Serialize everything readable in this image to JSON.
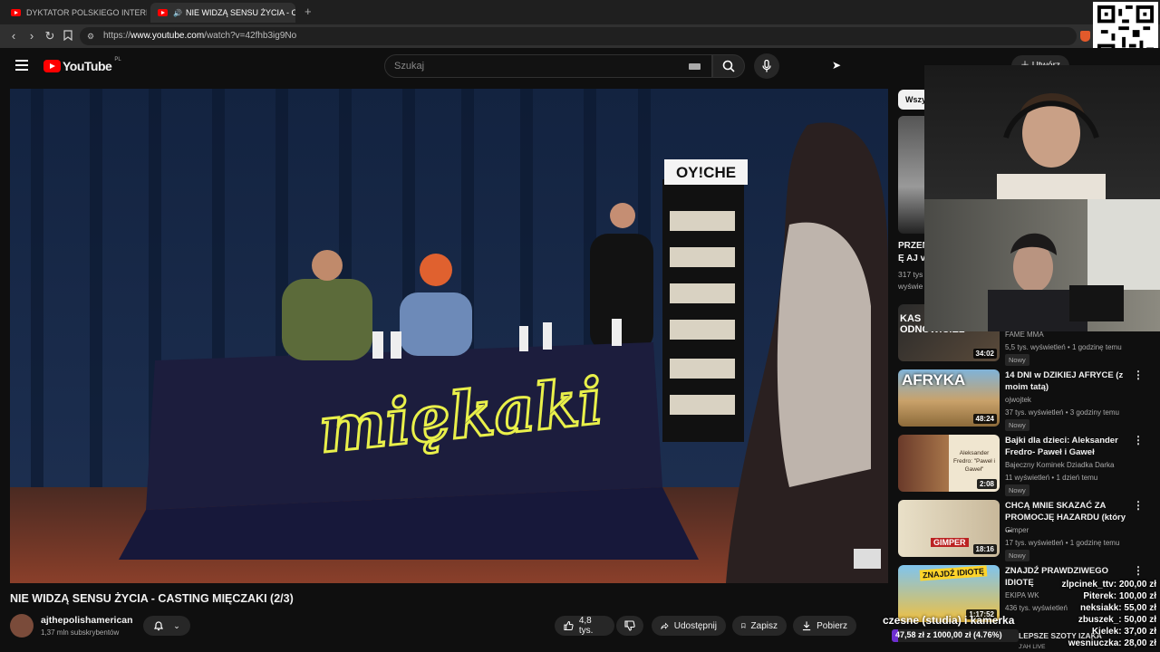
{
  "browser": {
    "tabs": [
      {
        "title": "DYKTATOR POLSKIEGO INTERNETU"
      },
      {
        "title": "NIE WIDZĄ SENSU ŻYCIA - CASTI"
      }
    ],
    "new_tab": "+",
    "url_prefix": "https://",
    "url_domain": "www.youtube.com",
    "url_path": "/watch?v=42fhb3ig9No"
  },
  "youtube": {
    "logo_text": "YouTube",
    "logo_region": "PL",
    "search_placeholder": "Szukaj",
    "create_label": "Utwórz"
  },
  "video": {
    "title": "NIE WIDZĄ SENSU ŻYCIA - CASTING MIĘCZAKI (2/3)",
    "banner_text": "miękaki",
    "fridge_sign": "OY!CHE",
    "channel_name": "ajthepolishamerican",
    "subscribers": "1,37 mln subskrybentów",
    "likes": "4,8 tys.",
    "share_label": "Udostępnij",
    "save_label": "Zapisz",
    "download_label": "Pobierz"
  },
  "sidebar": {
    "filter_chip": "Wszy",
    "partial_item": {
      "title_line1": "PRZEN",
      "title_line2": "Ę AJ v",
      "meta1": "317 tys",
      "meta2": "wyświe"
    },
    "items": [
      {
        "title": "",
        "thumb_text": "KAS ODNOWICIEL",
        "duration": "34:02",
        "channel": "FAME MMA",
        "meta": "5,5 tys. wyświetleń • 1 godzinę temu",
        "badge": "Nowy"
      },
      {
        "title": "14 DNI w DZIKIEJ AFRYCE (z moim tatą)",
        "thumb_text": "AFRYKA",
        "duration": "48:24",
        "channel": "ojwojtek",
        "meta": "37 tys. wyświetleń • 3 godziny temu",
        "badge": "Nowy"
      },
      {
        "title": "Bajki dla dzieci: Aleksander Fredro- Paweł i Gaweł",
        "thumb_text": "Aleksander Fredro: \"Paweł i Gaweł\"",
        "duration": "2:08",
        "channel": "Bajeczny Kominek Dziadka Darka",
        "meta": "11 wyświetleń • 1 dzień temu",
        "badge": "Nowy"
      },
      {
        "title": "CHCĄ MNIE SKAZAĆ ZA PROMOCJĘ HAZARDU (który ...",
        "thumb_text": "GIMPER",
        "duration": "18:16",
        "channel": "Gimper",
        "meta": "17 tys. wyświetleń • 1 godzinę temu",
        "badge": "Nowy"
      },
      {
        "title": "ZNAJDŹ PRAWDZIWEGO IDIOTĘ",
        "thumb_text": "ZNAJDŹ IDIOTĘ",
        "duration": "1:17:52",
        "channel": "EKIPA WK",
        "meta": "436 tys. wyświetleń",
        "badge": ""
      }
    ]
  },
  "stream_overlay": {
    "caption": "czesne (studia) i kamerka",
    "goal_text": "47,58 zł z 1000,00 zł (4.76%)",
    "goal_fraction": 0.0476,
    "ticker_text": "LEPSZE SZOTY IZAKA",
    "ticker_sub": "J'AH LIVE",
    "donations": [
      {
        "name": "zlpcinek_ttv:",
        "amount": "200,00 zł"
      },
      {
        "name": "Piterek:",
        "amount": "100,00 zł"
      },
      {
        "name": "neksiakk:",
        "amount": "55,00 zł"
      },
      {
        "name": "zbuszek_:",
        "amount": "50,00 zł"
      },
      {
        "name": "Kielek:",
        "amount": "37,00 zł"
      },
      {
        "name": "wesniuczka:",
        "amount": "28,00 zł"
      }
    ]
  },
  "colors": {
    "yt_red": "#ff0000",
    "neon_yellow": "#e9f04a",
    "curtain": "#1c2e4f"
  }
}
